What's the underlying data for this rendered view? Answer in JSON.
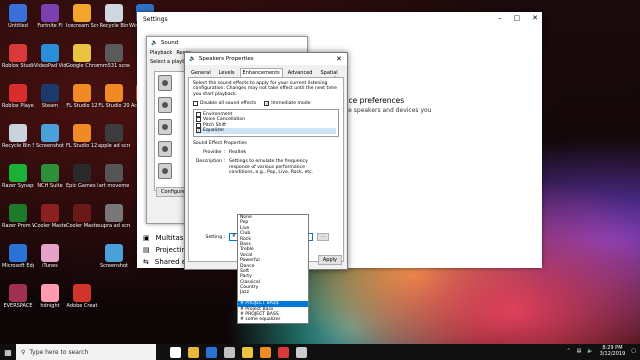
{
  "desktop_icons": [
    {
      "label": "Untitled",
      "color": "#3a6fd8"
    },
    {
      "label": "Fortnite Fl",
      "color": "#7b3fb0"
    },
    {
      "label": "Icecream Screen",
      "color": "#f2a52b"
    },
    {
      "label": "Recycle Bin",
      "color": "#cfd8e0"
    },
    {
      "label": "Windows Equ",
      "color": "#2b70c9"
    },
    {
      "label": "Roblox Studio",
      "color": "#d83a3a"
    },
    {
      "label": "VideoPad Video Editor",
      "color": "#2a8ed9"
    },
    {
      "label": "Google Chrome",
      "color": "#e9c341"
    },
    {
      "label": "mm531 screen vid",
      "color": "#5a5a5a"
    },
    {
      "label": "Roblox Player",
      "color": "#d82d2d"
    },
    {
      "label": "Steam",
      "color": "#1b3a6b"
    },
    {
      "label": "FL Studio 12",
      "color": "#f08a24"
    },
    {
      "label": "FL Studio 20",
      "color": "#f08a24"
    },
    {
      "label": "ActiThinker",
      "color": "#e45b2b"
    },
    {
      "label": "Recycle Bin Shortcut",
      "color": "#c9d3dc"
    },
    {
      "label": "Screenshot",
      "color": "#4aa0d8"
    },
    {
      "label": "FL Studio 12 (64bit)",
      "color": "#f08a24"
    },
    {
      "label": "apple ad screenshot",
      "color": "#3c3c3c"
    },
    {
      "label": "Razer Synapse 2",
      "color": "#1bb036"
    },
    {
      "label": "NCH Suite",
      "color": "#2d8f3a"
    },
    {
      "label": "Epic Games Launcher",
      "color": "#2a2a2a"
    },
    {
      "label": "art moveme",
      "color": "#555555"
    },
    {
      "label": "Razer Prom Wallpaper",
      "color": "#1c7a2a"
    },
    {
      "label": "Cooler Master Portal",
      "color": "#8a2020"
    },
    {
      "label": "Cooler Master",
      "color": "#6a1818"
    },
    {
      "label": "supra ad screensh",
      "color": "#777777"
    },
    {
      "label": "Microsoft Edge",
      "color": "#2a72d4"
    },
    {
      "label": "iTunes",
      "color": "#e6a3c8"
    },
    {
      "label": "Screenshot",
      "color": "#4aa0d8"
    },
    {
      "label": "EVERSPACE",
      "color": "#a03050"
    },
    {
      "label": "hdnight",
      "color": "#ff9ab0"
    },
    {
      "label": "Adobe Creat",
      "color": "#d3342a"
    }
  ],
  "settings": {
    "title": "Settings",
    "main_heading": "vice preferences",
    "main_text": "the speakers and devices you",
    "side_items": [
      {
        "label": "Multitaskin",
        "icon": "multitask-icon"
      },
      {
        "label": "Projecting",
        "icon": "project-icon"
      },
      {
        "label": "Shared experiences",
        "icon": "share-icon"
      }
    ]
  },
  "sound": {
    "title": "Sound",
    "tab_playback": "Playback",
    "tab_rec": "Recor",
    "hint": "Select a playb",
    "configure": "Configure"
  },
  "props": {
    "title": "Speakers Properties",
    "tabs": [
      "General",
      "Levels",
      "Enhancements",
      "Advanced",
      "Spatial sound"
    ],
    "active_tab": "Enhancements",
    "intro": "Select the sound effects to apply for your current listening configuration. Changes may not take effect until the next time you start playback.",
    "disable_all": "Disable all sound effects",
    "immediate": "Immediate mode",
    "effects": [
      {
        "label": "Environment",
        "checked": false
      },
      {
        "label": "Voice Cancellation",
        "checked": false
      },
      {
        "label": "Pitch Shift",
        "checked": false
      },
      {
        "label": "Equalizer",
        "checked": true
      }
    ],
    "group_label": "Sound Effect Properties",
    "provider_key": "Provider :",
    "provider_val": "Realtek",
    "description_key": "Description :",
    "description_val": "Settings to emulate the frequency response of various performance conditions,  e.g., Pop, Live, Rock, etc.",
    "setting_key": "Setting :",
    "setting_val": "# PROJECT BA$$",
    "dots": "...",
    "apply": "Apply"
  },
  "dropdown": {
    "items": [
      "None",
      "Pop",
      "Live",
      "Club",
      "Rock",
      "Bass",
      "Treble",
      "Vocal",
      "Powerful",
      "Dance",
      "Soft",
      "Party",
      "Classical",
      "Country",
      "Jazz",
      "",
      "# PROJECT BA$$",
      "# Project Bass",
      "# PROJECT BASS",
      "# some equalizer"
    ],
    "selected": "# PROJECT BA$$"
  },
  "taskbar": {
    "search_placeholder": "Type here to search",
    "time": "8:29 PM",
    "date": "3/12/2019",
    "icon_colors": [
      "#ffffff",
      "#e8b83a",
      "#2a72d4",
      "#c0c0c0",
      "#e9c341",
      "#f08a24",
      "#d83a3a",
      "#cccccc"
    ]
  }
}
